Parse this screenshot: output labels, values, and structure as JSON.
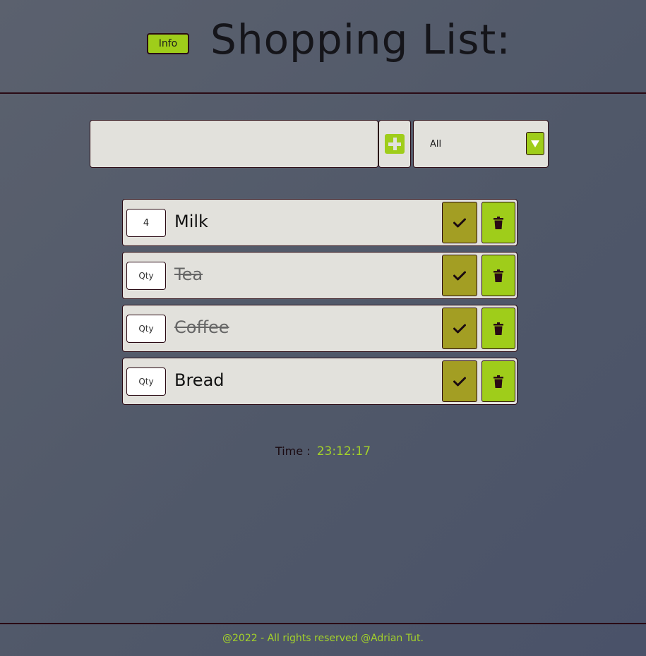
{
  "header": {
    "info_label": "Info",
    "title": "Shopping List:"
  },
  "toolbar": {
    "input_value": "",
    "filter_value": "All"
  },
  "items": [
    {
      "qty": "4",
      "qty_placeholder": "Qty",
      "name": "Milk",
      "done": false
    },
    {
      "qty": "",
      "qty_placeholder": "Qty",
      "name": "Tea",
      "done": true
    },
    {
      "qty": "",
      "qty_placeholder": "Qty",
      "name": "Coffee",
      "done": true
    },
    {
      "qty": "",
      "qty_placeholder": "Qty",
      "name": "Bread",
      "done": false
    }
  ],
  "time": {
    "label": "Time :",
    "value": "23:12:17"
  },
  "footer": {
    "text": "@2022 - All rights reserved @Adrian Tut."
  },
  "colors": {
    "accent_green": "#9fcd1a",
    "olive_check": "#a39e23",
    "border_dark": "#2a0a14",
    "panel_bg": "#e2e1dc"
  }
}
